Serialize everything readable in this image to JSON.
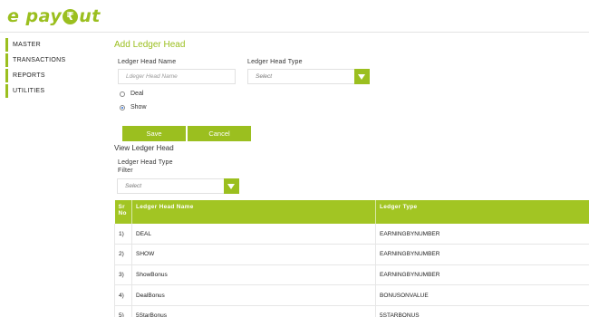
{
  "brand": {
    "logo_before": "e pay",
    "logo_coin": "₹",
    "logo_after": "ut",
    "accent_color": "#9bbf1f"
  },
  "sidebar": {
    "items": [
      {
        "label": "MASTER"
      },
      {
        "label": "TRANSACTIONS"
      },
      {
        "label": "REPORTS"
      },
      {
        "label": "UTILITIES"
      }
    ]
  },
  "form": {
    "title": "Add Ledger Head",
    "name_label": "Ledger Head Name",
    "name_placeholder": "Ldeger Head Name",
    "type_label": "Ledger Head Type",
    "type_selected": "Select",
    "radio_options": [
      {
        "label": "Deal",
        "checked": false
      },
      {
        "label": "Show",
        "checked": true
      }
    ],
    "save_label": "Save",
    "cancel_label": "Cancel"
  },
  "view": {
    "title": "View Ledger Head",
    "filter_label_line1": "Ledger Head Type",
    "filter_label_line2": "Filter",
    "filter_selected": "Select"
  },
  "table": {
    "headers": {
      "sr": "Sr\nNo",
      "name": "Ledger Head Name",
      "type": "Ledger Type"
    },
    "rows": [
      {
        "sr": "1)",
        "name": "DEAL",
        "type": "EARNINGBYNUMBER"
      },
      {
        "sr": "2)",
        "name": "SHOW",
        "type": "EARNINGBYNUMBER"
      },
      {
        "sr": "3)",
        "name": "ShowBonus",
        "type": "EARNINGBYNUMBER"
      },
      {
        "sr": "4)",
        "name": "DealBonus",
        "type": "BONUSONVALUE"
      },
      {
        "sr": "5)",
        "name": "5StarBonus",
        "type": "5STARBONUS"
      }
    ]
  }
}
